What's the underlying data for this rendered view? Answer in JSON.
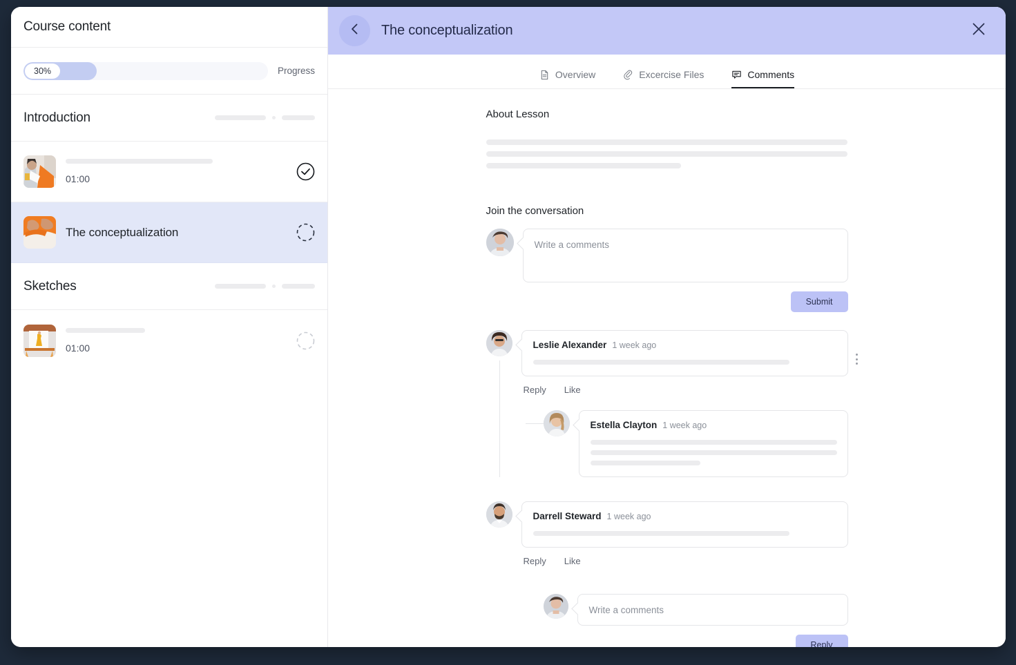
{
  "sidebar": {
    "title": "Course content",
    "progress": {
      "value": "30%",
      "percent": 30,
      "label": "Progress"
    },
    "sections": [
      {
        "title": "Introduction",
        "lessons": [
          {
            "name": "",
            "time": "01:00",
            "status": "completed",
            "thumb": "woman-sewing",
            "active": false
          },
          {
            "name": "The conceptualization",
            "time": "",
            "status": "pending",
            "thumb": "hands-fabric",
            "active": true
          }
        ]
      },
      {
        "title": "Sketches",
        "lessons": [
          {
            "name": "",
            "time": "01:00",
            "status": "pending",
            "thumb": "sketch-board",
            "active": false
          }
        ]
      }
    ]
  },
  "topbar": {
    "title": "The conceptualization",
    "back_icon": "chevron-left-icon",
    "close_icon": "close-icon",
    "bg_color": "#c3c8f7"
  },
  "tabs": [
    {
      "label": "Overview",
      "icon": "document-icon",
      "active": false
    },
    {
      "label": "Excercise Files",
      "icon": "paperclip-icon",
      "active": false
    },
    {
      "label": "Comments",
      "icon": "comment-icon",
      "active": true
    }
  ],
  "about": {
    "heading": "About Lesson"
  },
  "conversation": {
    "heading": "Join the conversation",
    "compose_placeholder": "Write a comments",
    "submit_label": "Submit",
    "reply_placeholder": "Write a comments",
    "reply_label": "Reply",
    "accent_color": "#bcc2f6"
  },
  "comments": [
    {
      "author": "Leslie Alexander",
      "time": "1 week ago",
      "avatar": "woman-curly-hair",
      "actions": {
        "reply": "Reply",
        "like": "Like"
      },
      "menu_icon": "kebab-menu-icon",
      "replies": [
        {
          "author": "Estella Clayton",
          "time": "1 week ago",
          "avatar": "woman-blonde"
        }
      ]
    },
    {
      "author": "Darrell Steward",
      "time": "1 week ago",
      "avatar": "man-beard",
      "actions": {
        "reply": "Reply",
        "like": "Like"
      },
      "replies": []
    }
  ]
}
